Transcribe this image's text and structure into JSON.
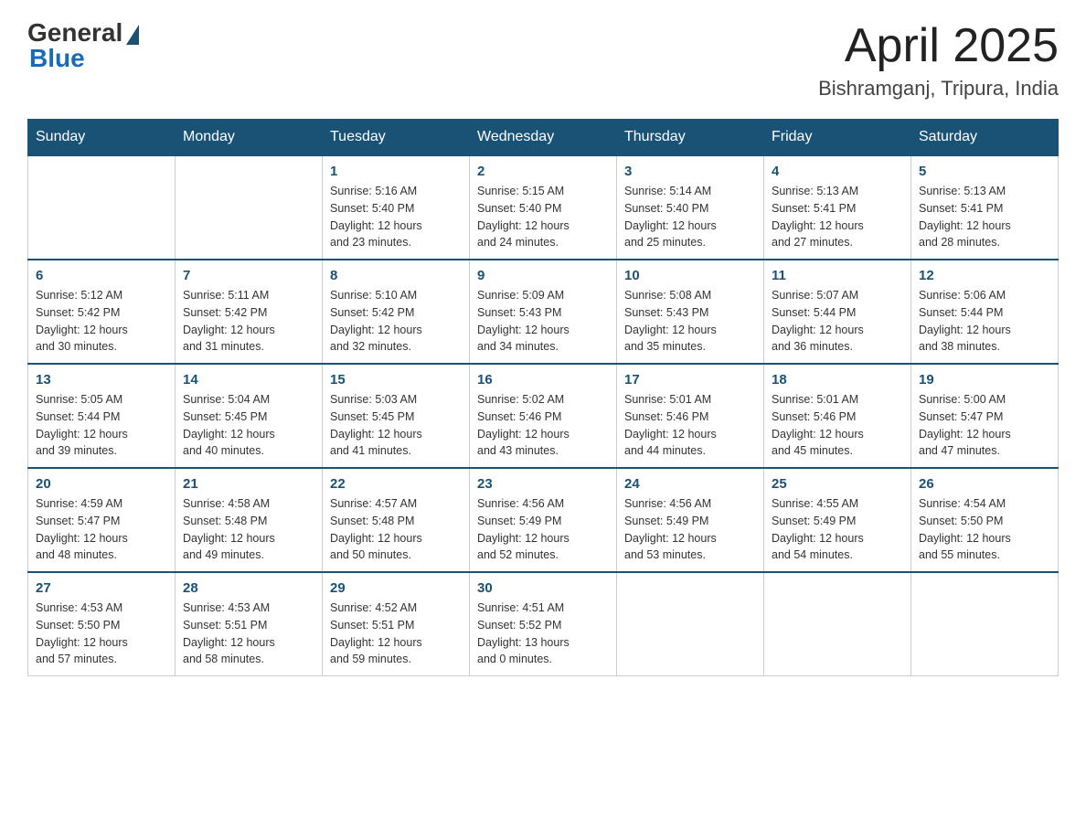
{
  "header": {
    "logo_general": "General",
    "logo_blue": "Blue",
    "title": "April 2025",
    "subtitle": "Bishramganj, Tripura, India"
  },
  "weekdays": [
    "Sunday",
    "Monday",
    "Tuesday",
    "Wednesday",
    "Thursday",
    "Friday",
    "Saturday"
  ],
  "weeks": [
    [
      {
        "day": "",
        "info": ""
      },
      {
        "day": "",
        "info": ""
      },
      {
        "day": "1",
        "info": "Sunrise: 5:16 AM\nSunset: 5:40 PM\nDaylight: 12 hours\nand 23 minutes."
      },
      {
        "day": "2",
        "info": "Sunrise: 5:15 AM\nSunset: 5:40 PM\nDaylight: 12 hours\nand 24 minutes."
      },
      {
        "day": "3",
        "info": "Sunrise: 5:14 AM\nSunset: 5:40 PM\nDaylight: 12 hours\nand 25 minutes."
      },
      {
        "day": "4",
        "info": "Sunrise: 5:13 AM\nSunset: 5:41 PM\nDaylight: 12 hours\nand 27 minutes."
      },
      {
        "day": "5",
        "info": "Sunrise: 5:13 AM\nSunset: 5:41 PM\nDaylight: 12 hours\nand 28 minutes."
      }
    ],
    [
      {
        "day": "6",
        "info": "Sunrise: 5:12 AM\nSunset: 5:42 PM\nDaylight: 12 hours\nand 30 minutes."
      },
      {
        "day": "7",
        "info": "Sunrise: 5:11 AM\nSunset: 5:42 PM\nDaylight: 12 hours\nand 31 minutes."
      },
      {
        "day": "8",
        "info": "Sunrise: 5:10 AM\nSunset: 5:42 PM\nDaylight: 12 hours\nand 32 minutes."
      },
      {
        "day": "9",
        "info": "Sunrise: 5:09 AM\nSunset: 5:43 PM\nDaylight: 12 hours\nand 34 minutes."
      },
      {
        "day": "10",
        "info": "Sunrise: 5:08 AM\nSunset: 5:43 PM\nDaylight: 12 hours\nand 35 minutes."
      },
      {
        "day": "11",
        "info": "Sunrise: 5:07 AM\nSunset: 5:44 PM\nDaylight: 12 hours\nand 36 minutes."
      },
      {
        "day": "12",
        "info": "Sunrise: 5:06 AM\nSunset: 5:44 PM\nDaylight: 12 hours\nand 38 minutes."
      }
    ],
    [
      {
        "day": "13",
        "info": "Sunrise: 5:05 AM\nSunset: 5:44 PM\nDaylight: 12 hours\nand 39 minutes."
      },
      {
        "day": "14",
        "info": "Sunrise: 5:04 AM\nSunset: 5:45 PM\nDaylight: 12 hours\nand 40 minutes."
      },
      {
        "day": "15",
        "info": "Sunrise: 5:03 AM\nSunset: 5:45 PM\nDaylight: 12 hours\nand 41 minutes."
      },
      {
        "day": "16",
        "info": "Sunrise: 5:02 AM\nSunset: 5:46 PM\nDaylight: 12 hours\nand 43 minutes."
      },
      {
        "day": "17",
        "info": "Sunrise: 5:01 AM\nSunset: 5:46 PM\nDaylight: 12 hours\nand 44 minutes."
      },
      {
        "day": "18",
        "info": "Sunrise: 5:01 AM\nSunset: 5:46 PM\nDaylight: 12 hours\nand 45 minutes."
      },
      {
        "day": "19",
        "info": "Sunrise: 5:00 AM\nSunset: 5:47 PM\nDaylight: 12 hours\nand 47 minutes."
      }
    ],
    [
      {
        "day": "20",
        "info": "Sunrise: 4:59 AM\nSunset: 5:47 PM\nDaylight: 12 hours\nand 48 minutes."
      },
      {
        "day": "21",
        "info": "Sunrise: 4:58 AM\nSunset: 5:48 PM\nDaylight: 12 hours\nand 49 minutes."
      },
      {
        "day": "22",
        "info": "Sunrise: 4:57 AM\nSunset: 5:48 PM\nDaylight: 12 hours\nand 50 minutes."
      },
      {
        "day": "23",
        "info": "Sunrise: 4:56 AM\nSunset: 5:49 PM\nDaylight: 12 hours\nand 52 minutes."
      },
      {
        "day": "24",
        "info": "Sunrise: 4:56 AM\nSunset: 5:49 PM\nDaylight: 12 hours\nand 53 minutes."
      },
      {
        "day": "25",
        "info": "Sunrise: 4:55 AM\nSunset: 5:49 PM\nDaylight: 12 hours\nand 54 minutes."
      },
      {
        "day": "26",
        "info": "Sunrise: 4:54 AM\nSunset: 5:50 PM\nDaylight: 12 hours\nand 55 minutes."
      }
    ],
    [
      {
        "day": "27",
        "info": "Sunrise: 4:53 AM\nSunset: 5:50 PM\nDaylight: 12 hours\nand 57 minutes."
      },
      {
        "day": "28",
        "info": "Sunrise: 4:53 AM\nSunset: 5:51 PM\nDaylight: 12 hours\nand 58 minutes."
      },
      {
        "day": "29",
        "info": "Sunrise: 4:52 AM\nSunset: 5:51 PM\nDaylight: 12 hours\nand 59 minutes."
      },
      {
        "day": "30",
        "info": "Sunrise: 4:51 AM\nSunset: 5:52 PM\nDaylight: 13 hours\nand 0 minutes."
      },
      {
        "day": "",
        "info": ""
      },
      {
        "day": "",
        "info": ""
      },
      {
        "day": "",
        "info": ""
      }
    ]
  ]
}
